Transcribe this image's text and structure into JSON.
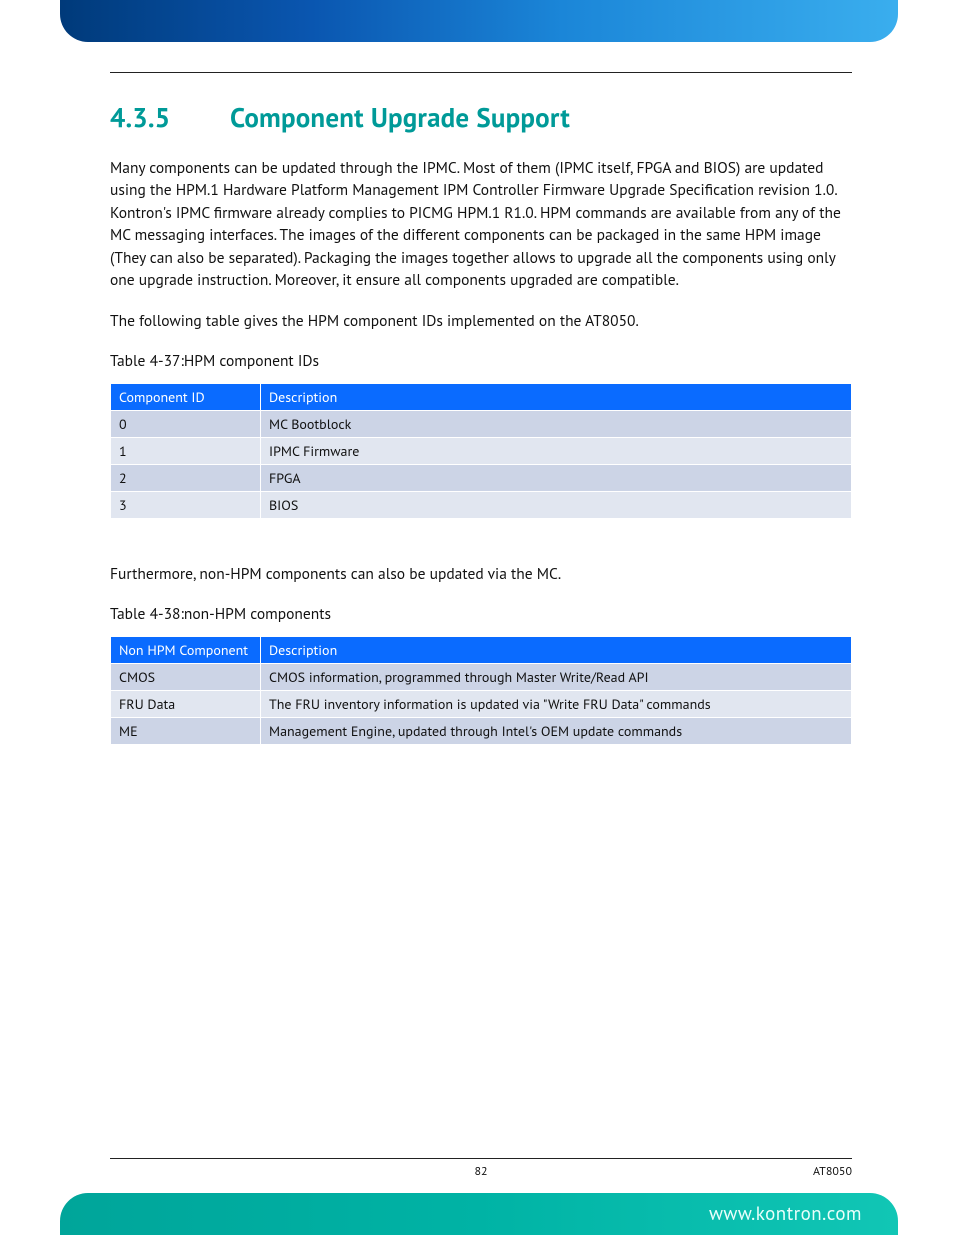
{
  "heading": {
    "number": "4.3.5",
    "title": "Component Upgrade Support"
  },
  "paragraphs": {
    "p1": "Many components can be updated through the IPMC. Most of them (IPMC itself, FPGA and BIOS) are updated using the HPM.1 Hardware Platform Management IPM Controller Firmware Upgrade  Specification revision 1.0. Kontron's IPMC firmware already complies to PICMG HPM.1 R1.0. HPM commands are available from any of the MC messaging interfaces. The images of the different components can be packaged in the same HPM image (They can also be separated). Packaging the images together allows to upgrade all the components using only one upgrade instruction. Moreover, it ensure all components upgraded are compatible.",
    "p2": "The following table gives the HPM component IDs implemented on the AT8050.",
    "p3": "Furthermore, non-HPM components can also be updated via the MC."
  },
  "table1": {
    "caption": "Table 4-37:HPM component IDs",
    "headers": {
      "h1": "Component ID",
      "h2": "Description"
    },
    "rows": [
      {
        "c1": "0",
        "c2": "MC Bootblock"
      },
      {
        "c1": "1",
        "c2": "IPMC Firmware"
      },
      {
        "c1": "2",
        "c2": "FPGA"
      },
      {
        "c1": "3",
        "c2": "BIOS"
      }
    ]
  },
  "table2": {
    "caption": "Table 4-38:non-HPM components",
    "headers": {
      "h1": "Non HPM Component",
      "h2": "Description"
    },
    "rows": [
      {
        "c1": "CMOS",
        "c2": "CMOS information, programmed through Master Write/Read API"
      },
      {
        "c1": "FRU Data",
        "c2": "The FRU inventory information is updated via \"Write FRU Data\" commands"
      },
      {
        "c1": "ME",
        "c2": "Management Engine, updated through Intel's OEM update commands"
      }
    ]
  },
  "footer": {
    "page": "82",
    "doc": "AT8050",
    "url": "www.kontron.com"
  }
}
